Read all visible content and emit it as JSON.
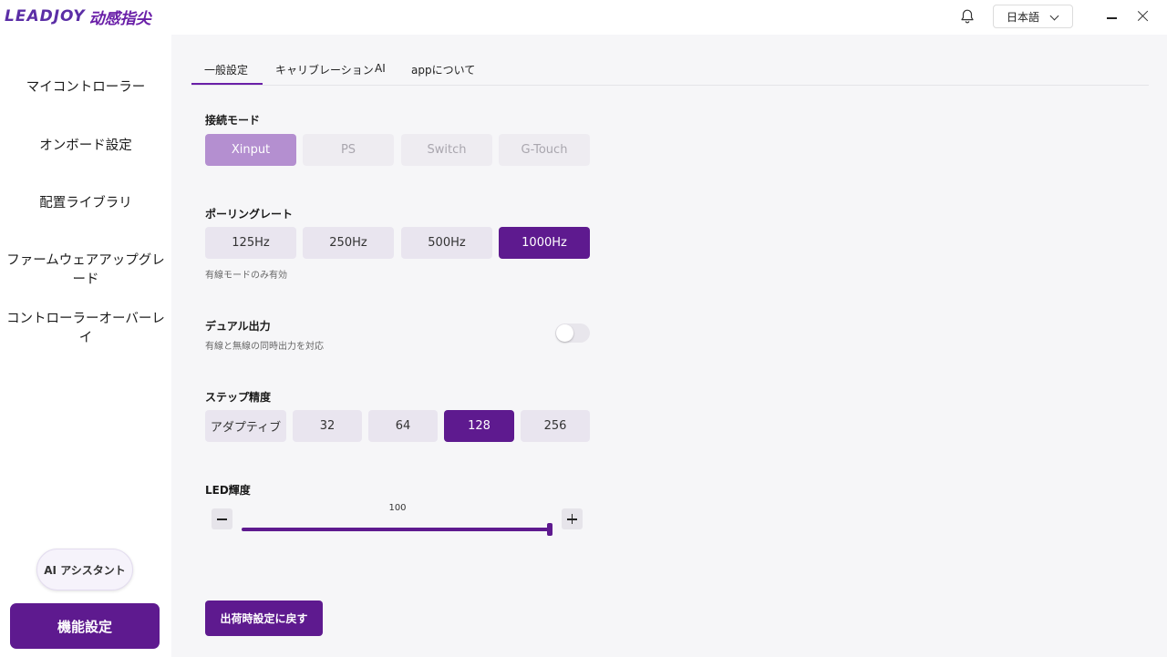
{
  "app": {
    "logo_text": "LEADJOY",
    "logo_cn": "动感指尖",
    "language": "日本語"
  },
  "sidebar": {
    "items": [
      {
        "label": "マイコントローラー"
      },
      {
        "label": "オンボード設定"
      },
      {
        "label": "配置ライブラリ"
      },
      {
        "label": "ファームウェアアップグレード"
      },
      {
        "label": "コントローラーオーバーレイ"
      }
    ],
    "ai_assistant": "AI アシスタント",
    "feature_settings": "機能設定"
  },
  "tabs": [
    {
      "label": "一般設定",
      "active": true
    },
    {
      "label": "キャリブレーション",
      "active": false
    },
    {
      "label": "AI",
      "active": false
    },
    {
      "label": "appについて",
      "active": false
    }
  ],
  "connection_mode": {
    "label": "接続モード",
    "options": [
      "Xinput",
      "PS",
      "Switch",
      "G-Touch"
    ],
    "selected": "Xinput"
  },
  "polling_rate": {
    "label": "ポーリングレート",
    "options": [
      "125Hz",
      "250Hz",
      "500Hz",
      "1000Hz"
    ],
    "selected": "1000Hz",
    "note": "有線モードのみ有効"
  },
  "dual_output": {
    "label": "デュアル出力",
    "description": "有線と無線の同時出力を対応",
    "enabled": false
  },
  "step_precision": {
    "label": "ステップ精度",
    "options": [
      "アダプティブ",
      "32",
      "64",
      "128",
      "256"
    ],
    "selected": "128"
  },
  "led_brightness": {
    "label": "LED輝度",
    "value": "100",
    "fraction": 1.0
  },
  "reset_button": "出荷時設定に戻す",
  "colors": {
    "accent": "#5e1a8f",
    "accent_light": "#b48fd0"
  }
}
